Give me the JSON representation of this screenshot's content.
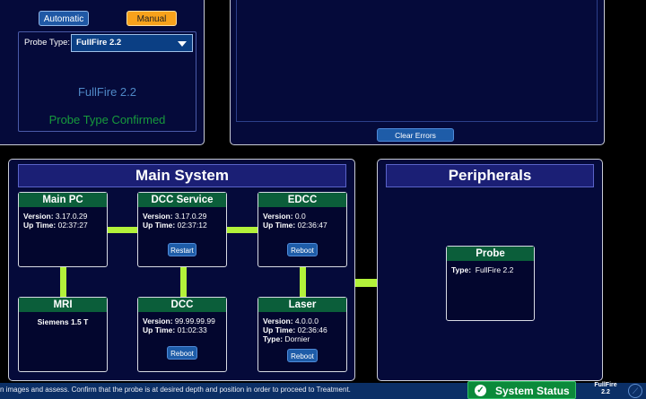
{
  "probe_panel": {
    "automatic_label": "Automatic",
    "manual_label": "Manual",
    "probe_type_label": "Probe Type:",
    "probe_type_value": "FullFire 2.2",
    "current_probe": "FullFire 2.2",
    "status": "Probe Type Confirmed"
  },
  "errors_panel": {
    "clear_errors_label": "Clear Errors"
  },
  "main_system": {
    "title": "Main System",
    "main_pc": {
      "title": "Main PC",
      "version_label": "Version:",
      "version": "3.17.0.29",
      "uptime_label": "Up Time:",
      "uptime": "02:37:27"
    },
    "dcc_service": {
      "title": "DCC Service",
      "version_label": "Version:",
      "version": "3.17.0.29",
      "uptime_label": "Up Time:",
      "uptime": "02:37:12",
      "button": "Restart"
    },
    "edcc": {
      "title": "EDCC",
      "version_label": "Version:",
      "version": "0.0",
      "uptime_label": "Up Time:",
      "uptime": "02:36:47",
      "button": "Reboot"
    },
    "mri": {
      "title": "MRI",
      "detail": "Siemens  1.5  T"
    },
    "dcc": {
      "title": "DCC",
      "version_label": "Version:",
      "version": "99.99.99.99",
      "uptime_label": "Up Time:",
      "uptime": "01:02:33",
      "button": "Reboot"
    },
    "laser": {
      "title": "Laser",
      "version_label": "Version:",
      "version": "4.0.0.0",
      "uptime_label": "Up Time:",
      "uptime": "02:36:46",
      "type_label": "Type:",
      "type": "Dornier",
      "button": "Reboot"
    }
  },
  "peripherals": {
    "title": "Peripherals",
    "probe": {
      "title": "Probe",
      "type_label": "Type:",
      "type": "FullFire 2.2"
    }
  },
  "status_bar": {
    "message": "n images and assess. Confirm that the probe is at desired depth and position in order to proceed to Treatment.",
    "system_status_label": "System Status",
    "probe_line1": "FullFire",
    "probe_line2": "2.2"
  },
  "colors": {
    "accent_green": "#b3f23a",
    "manual_orange": "#f7a21b",
    "status_green": "#0b8a3a",
    "panel_navy": "#050a3a"
  }
}
